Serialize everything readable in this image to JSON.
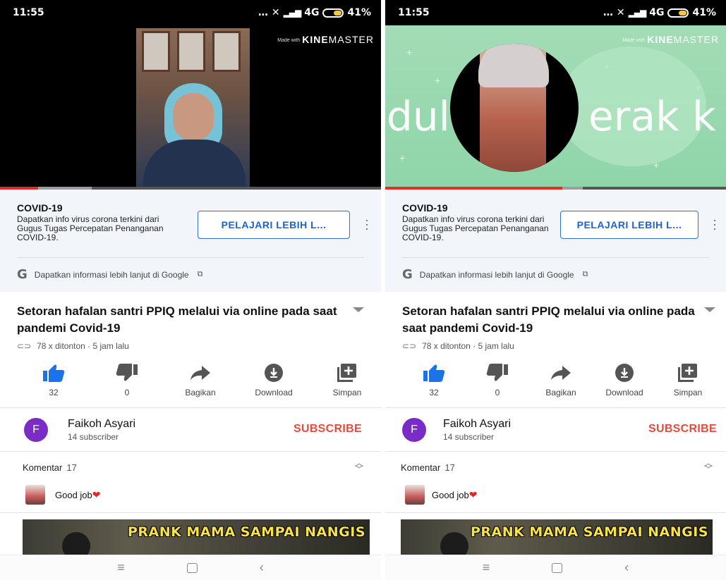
{
  "screens": [
    {
      "id": "left",
      "status": {
        "time": "11:55",
        "network": "4G",
        "battery": "41%"
      },
      "watermark": {
        "prefix": "Made with",
        "brand_bold": "KINE",
        "brand_light": "MASTER"
      },
      "video_progress": {
        "played": 0.1,
        "buffered_to": 0.24
      },
      "ad": {
        "title": "COVID-19",
        "description": "Dapatkan info virus corona terkini dari Gugus Tugas Percepatan Penanganan COVID-19.",
        "button": "PELAJARI LEBIH L...",
        "footer": "Dapatkan informasi lebih lanjut di Google"
      },
      "video": {
        "title": "Setoran hafalan santri PPIQ melalui via online pada saat pandemi Covid-19",
        "meta": "78 x ditonton · 5 jam lalu"
      },
      "actions": {
        "like": "32",
        "dislike": "0",
        "share": "Bagikan",
        "download": "Download",
        "save": "Simpan"
      },
      "channel": {
        "avatar_letter": "F",
        "name": "Faikoh Asyari",
        "subscribers": "14 subscriber",
        "subscribe": "SUBSCRIBE"
      },
      "comments": {
        "label": "Komentar",
        "count": "17",
        "top_comment": "Good job"
      },
      "next_video": {
        "thumbnail_text": "PRANK MAMA SAMPAI NANGIS"
      },
      "colors": {
        "accent_blue": "#1a62d4",
        "subscribe_red": "#e64a3b",
        "avatar_purple": "#7b2bc6"
      }
    },
    {
      "id": "right",
      "status": {
        "time": "11:55",
        "network": "4G",
        "battery": "41%"
      },
      "watermark": {
        "prefix": "Made with",
        "brand_bold": "KINE",
        "brand_light": "MASTER"
      },
      "video_progress": {
        "played": 0.52,
        "buffered_to": 0.58
      },
      "video_bg_text": {
        "left": "dul",
        "right": "erak k"
      },
      "ad": {
        "title": "COVID-19",
        "description": "Dapatkan info virus corona terkini dari Gugus Tugas Percepatan Penanganan COVID-19.",
        "button": "PELAJARI LEBIH L...",
        "footer": "Dapatkan informasi lebih lanjut di Google"
      },
      "video": {
        "title": "Setoran hafalan santri PPIQ melalui via online pada saat pandemi Covid-19",
        "meta": "78 x ditonton · 5 jam lalu"
      },
      "actions": {
        "like": "32",
        "dislike": "0",
        "share": "Bagikan",
        "download": "Download",
        "save": "Simpan"
      },
      "channel": {
        "avatar_letter": "F",
        "name": "Faikoh Asyari",
        "subscribers": "14 subscriber",
        "subscribe": "SUBSCRIBE"
      },
      "comments": {
        "label": "Komentar",
        "count": "17",
        "top_comment": "Good job"
      },
      "next_video": {
        "thumbnail_text": "PRANK MAMA SAMPAI NANGIS"
      }
    }
  ]
}
